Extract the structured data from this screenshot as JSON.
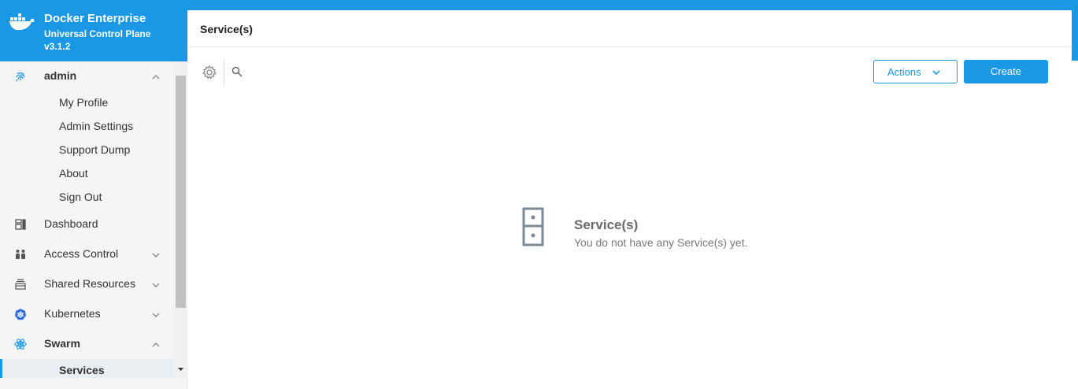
{
  "brand": {
    "product": "Docker Enterprise",
    "subtitle": "Universal Control Plane",
    "version": "v3.1.2",
    "color": "#1a98e6"
  },
  "sidebar": {
    "user": {
      "label": "admin",
      "icon": "fingerprint-icon",
      "expanded": true
    },
    "user_menu": [
      "My Profile",
      "Admin Settings",
      "Support Dump",
      "About",
      "Sign Out"
    ],
    "items": [
      {
        "label": "Dashboard",
        "icon": "dashboard-icon"
      },
      {
        "label": "Access Control",
        "icon": "users-icon",
        "expanded": false
      },
      {
        "label": "Shared Resources",
        "icon": "shared-resources-icon",
        "expanded": false
      },
      {
        "label": "Kubernetes",
        "icon": "kubernetes-icon",
        "expanded": false
      },
      {
        "label": "Swarm",
        "icon": "swarm-icon",
        "expanded": true
      }
    ],
    "swarm_sub": [
      {
        "label": "Services",
        "active": true
      }
    ]
  },
  "main": {
    "title": "Service(s)",
    "toolbar": {
      "actions_label": "Actions",
      "create_label": "Create"
    },
    "empty_state": {
      "title": "Service(s)",
      "message": "You do not have any Service(s) yet."
    }
  }
}
